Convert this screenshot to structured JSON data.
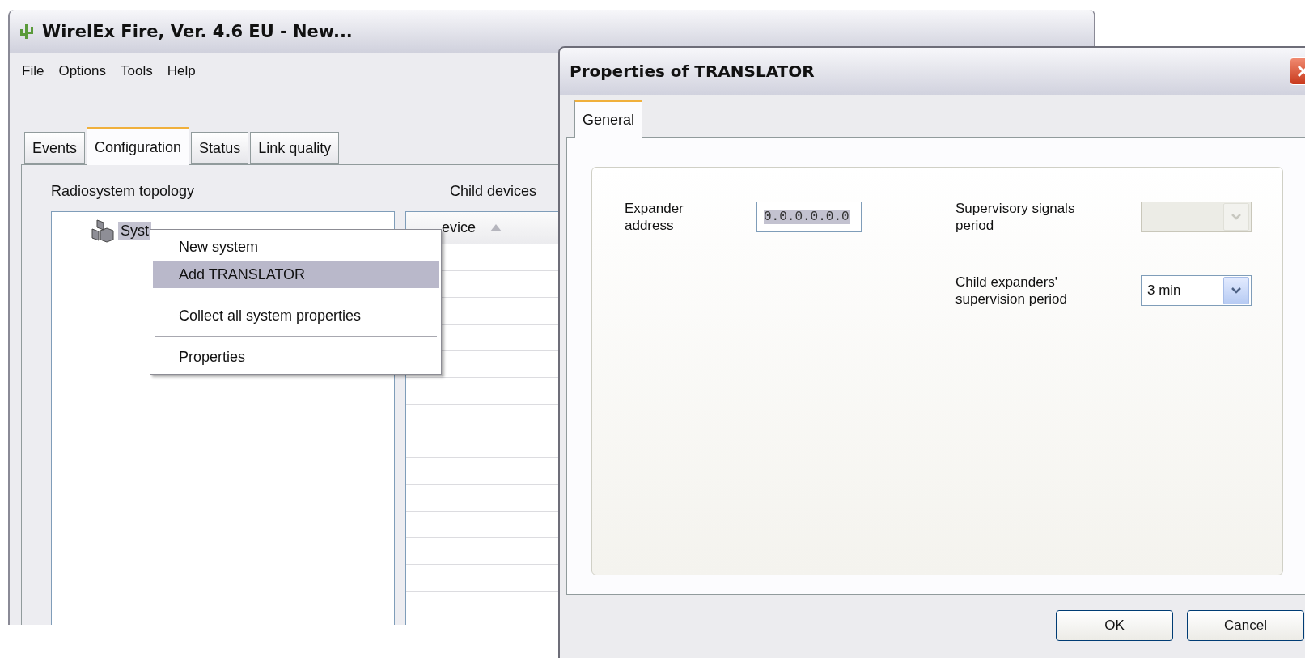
{
  "main_window": {
    "title": "WirelEx Fire, Ver. 4.6 EU - New...",
    "menu": [
      "File",
      "Options",
      "Tools",
      "Help"
    ],
    "tabs": [
      {
        "label": "Events",
        "selected": false
      },
      {
        "label": "Configuration",
        "selected": true
      },
      {
        "label": "Status",
        "selected": false
      },
      {
        "label": "Link quality",
        "selected": false
      }
    ],
    "topology": {
      "label": "Radiosystem topology",
      "tree": [
        {
          "label": "Syst",
          "selected": true
        }
      ]
    },
    "child_devices": {
      "label": "Child devices",
      "columns": [
        {
          "label": "evice",
          "sorted": true
        }
      ]
    }
  },
  "context_menu": {
    "items": [
      {
        "kind": "item",
        "label": "New system",
        "selected": false
      },
      {
        "kind": "item",
        "label": "Add TRANSLATOR",
        "selected": true
      },
      {
        "kind": "separator"
      },
      {
        "kind": "item",
        "label": "Collect all system properties",
        "selected": false
      },
      {
        "kind": "separator"
      },
      {
        "kind": "item",
        "label": "Properties",
        "selected": false
      }
    ]
  },
  "dialog": {
    "title": "Properties of TRANSLATOR",
    "tabs": [
      {
        "label": "General",
        "selected": true
      }
    ],
    "columns": [
      [
        {
          "kind": "text",
          "label": "Expander address",
          "value": "0.0.0.0.0.0",
          "disabled": false
        }
      ],
      [
        {
          "kind": "combo",
          "label": "Supervisory signals period",
          "disabled": true
        },
        {
          "kind": "combo",
          "label": "Child expanders' supervision period",
          "value": "3 min",
          "disabled": false
        }
      ]
    ],
    "buttons": [
      "OK",
      "Cancel"
    ]
  }
}
